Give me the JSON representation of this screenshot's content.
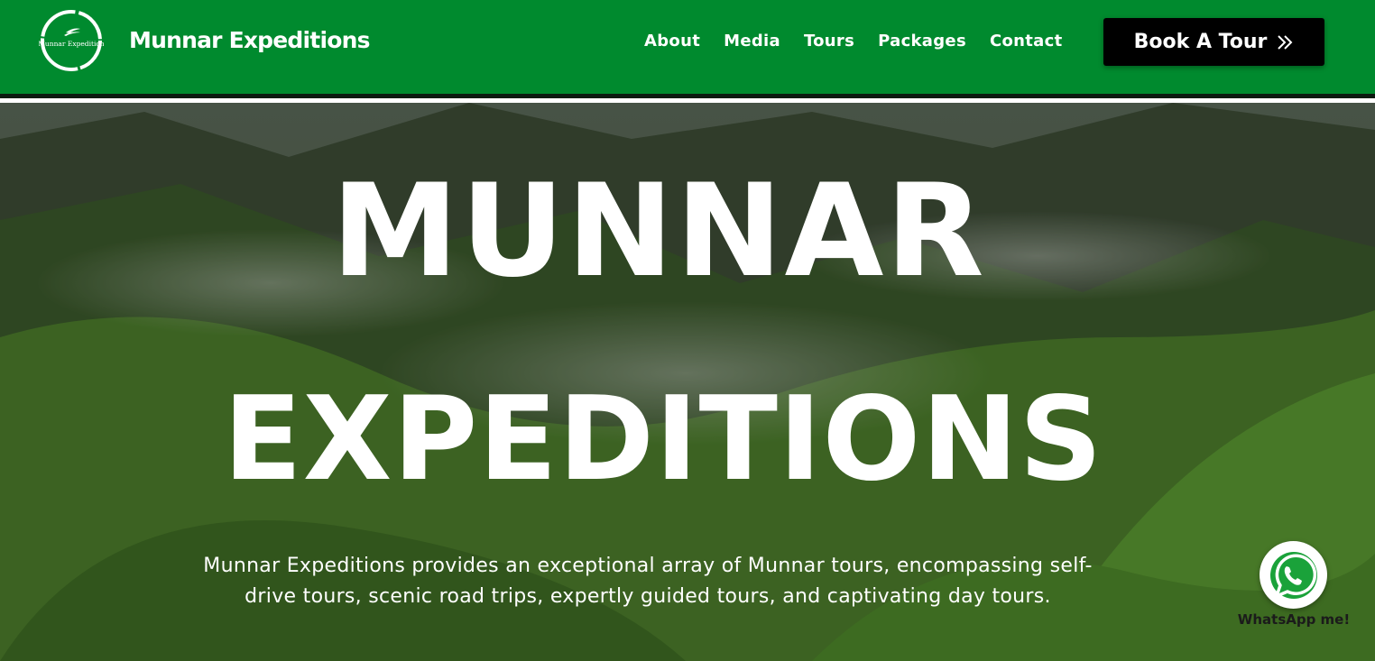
{
  "header": {
    "logo_text": "Munnar Expedition",
    "brand": "Munnar Expeditions",
    "nav": [
      {
        "label": "About"
      },
      {
        "label": "Media"
      },
      {
        "label": "Tours"
      },
      {
        "label": "Packages"
      },
      {
        "label": "Contact"
      }
    ],
    "cta_label": "Book A Tour",
    "cta_icon": "double-chevron-right-icon",
    "background_color": "#008a2e"
  },
  "hero": {
    "title_line1": "MUNNAR",
    "title_line2": "EXPEDITIONS",
    "description": "Munnar Expeditions provides an exceptional array of Munnar tours, encompassing self-drive tours, scenic road trips, expertly guided tours, and captivating day tours."
  },
  "whatsapp": {
    "label": "WhatsApp me!",
    "icon": "whatsapp-icon",
    "color": "#1aa23a"
  }
}
